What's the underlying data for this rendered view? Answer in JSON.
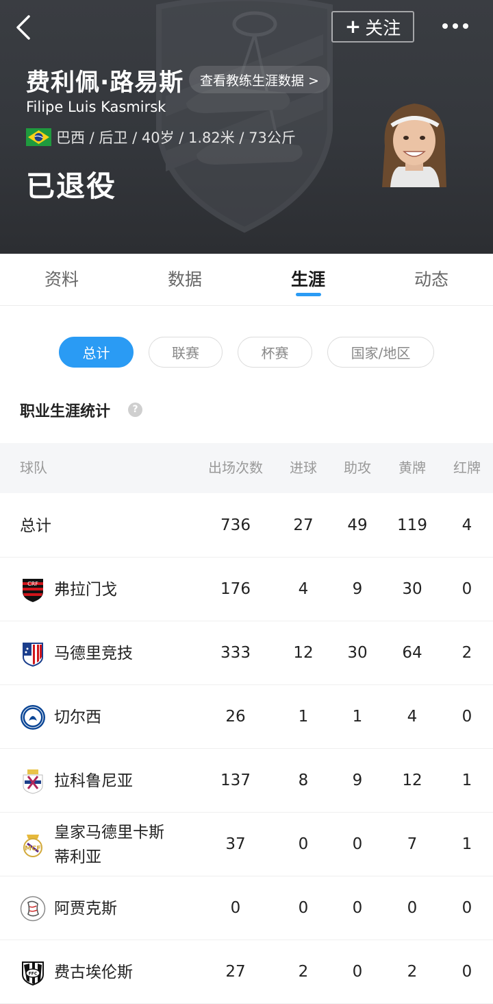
{
  "header": {
    "follow_label": "关注",
    "follow_plus": "+",
    "name_cn": "费利佩·路易斯",
    "coach_link": "查看教练生涯数据 >",
    "name_en": "Filipe Luis Kasmirsk",
    "bio": "巴西 / 后卫 / 40岁 / 1.82米 / 73公斤",
    "status": "已退役"
  },
  "tabs": [
    {
      "label": "资料"
    },
    {
      "label": "数据"
    },
    {
      "label": "生涯"
    },
    {
      "label": "动态"
    }
  ],
  "active_tab": "生涯",
  "filters": [
    {
      "label": "总计"
    },
    {
      "label": "联赛"
    },
    {
      "label": "杯赛"
    },
    {
      "label": "国家/地区"
    }
  ],
  "active_filter": "总计",
  "section_title": "职业生涯统计",
  "help_glyph": "?",
  "table": {
    "headers": [
      "球队",
      "出场次数",
      "进球",
      "助攻",
      "黄牌",
      "红牌"
    ],
    "rows": [
      {
        "team": "总计",
        "apps": "736",
        "goals": "27",
        "assists": "49",
        "yellow": "119",
        "red": "4",
        "logo": ""
      },
      {
        "team": "弗拉门戈",
        "apps": "176",
        "goals": "4",
        "assists": "9",
        "yellow": "30",
        "red": "0",
        "logo": "flamengo-crest"
      },
      {
        "team": "马德里竞技",
        "apps": "333",
        "goals": "12",
        "assists": "30",
        "yellow": "64",
        "red": "2",
        "logo": "atletico-crest"
      },
      {
        "team": "切尔西",
        "apps": "26",
        "goals": "1",
        "assists": "1",
        "yellow": "4",
        "red": "0",
        "logo": "chelsea-crest"
      },
      {
        "team": "拉科鲁尼亚",
        "apps": "137",
        "goals": "8",
        "assists": "9",
        "yellow": "12",
        "red": "1",
        "logo": "deportivo-crest"
      },
      {
        "team": "皇家马德里卡斯蒂利亚",
        "team_line1": "皇家马德里卡斯",
        "team_line2": "蒂利亚",
        "apps": "37",
        "goals": "0",
        "assists": "0",
        "yellow": "7",
        "red": "1",
        "logo": "real-madrid-crest"
      },
      {
        "team": "阿贾克斯",
        "apps": "0",
        "goals": "0",
        "assists": "0",
        "yellow": "0",
        "red": "0",
        "logo": "ajax-crest"
      },
      {
        "team": "费古埃伦斯",
        "apps": "27",
        "goals": "2",
        "assists": "0",
        "yellow": "2",
        "red": "0",
        "logo": "figueirense-crest"
      }
    ]
  },
  "colors": {
    "accent": "#2a9bf4",
    "header_bg": "#36393e"
  }
}
